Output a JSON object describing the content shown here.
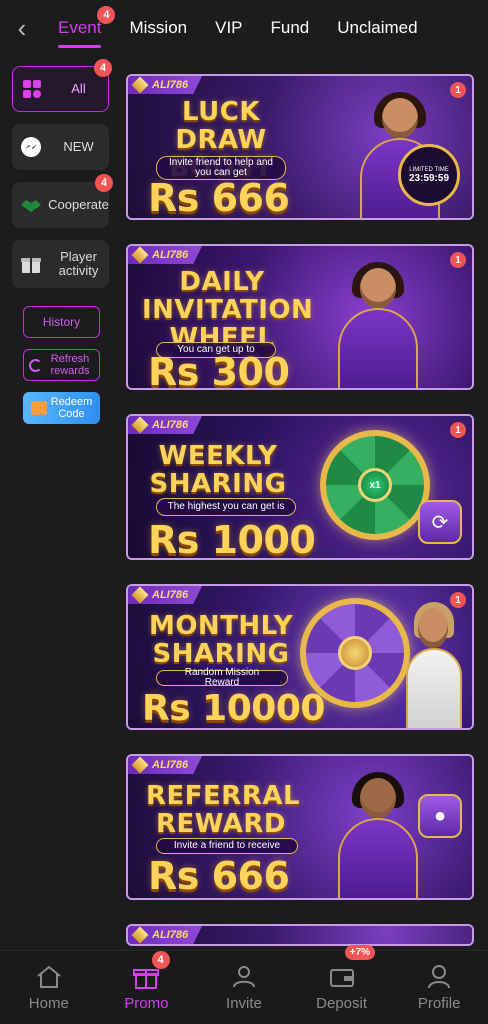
{
  "header": {
    "tabs": [
      {
        "label": "Event",
        "active": true,
        "badge": "4"
      },
      {
        "label": "Mission"
      },
      {
        "label": "VIP"
      },
      {
        "label": "Fund"
      },
      {
        "label": "Unclaimed"
      }
    ]
  },
  "sidebar": {
    "items": [
      {
        "label": "All",
        "badge": "4",
        "active": true,
        "icon": "grid-icon"
      },
      {
        "label": "NEW",
        "icon": "messenger-icon"
      },
      {
        "label": "Cooperate",
        "badge": "4",
        "icon": "handshake-icon"
      },
      {
        "label": "Player activity",
        "icon": "gift-icon"
      }
    ],
    "history_label": "History",
    "refresh_label": "Refresh rewards",
    "redeem_label": "Redeem Code"
  },
  "banners": [
    {
      "brand": "ALI786",
      "badge": "1",
      "title": "LUCK DRAW BOOST",
      "subtitle": "Invite friend to help and you can get",
      "amount": "Rs 666",
      "timer_label": "LIMITED TIME",
      "timer_value": "23:59:59"
    },
    {
      "brand": "ALI786",
      "badge": "1",
      "title": "DAILY INVITATION WHEEL",
      "subtitle": "You can get up to",
      "amount": "Rs 300"
    },
    {
      "brand": "ALI786",
      "badge": "1",
      "title": "WEEKLY SHARING",
      "subtitle": "The highest you can get is",
      "amount": "Rs 1000",
      "wheel_hub": "x1"
    },
    {
      "brand": "ALI786",
      "badge": "1",
      "title": "MONTHLY SHARING",
      "subtitle": "Random Mission Reward",
      "amount": "Rs 10000"
    },
    {
      "brand": "ALI786",
      "title": "REFERRAL REWARD",
      "subtitle": "Invite a friend to receive",
      "amount": "Rs 666"
    },
    {
      "brand": "ALI786"
    }
  ],
  "bottom_nav": [
    {
      "label": "Home",
      "icon": "home-icon"
    },
    {
      "label": "Promo",
      "icon": "gift-icon",
      "active": true,
      "badge": "4"
    },
    {
      "label": "Invite",
      "icon": "users-icon"
    },
    {
      "label": "Deposit",
      "icon": "wallet-icon",
      "badge": "+7%"
    },
    {
      "label": "Profile",
      "icon": "user-icon"
    }
  ],
  "colors": {
    "accent": "#d63cf0",
    "badge": "#f05454",
    "gold": "#ffd35a",
    "background": "#1c1c1e"
  }
}
